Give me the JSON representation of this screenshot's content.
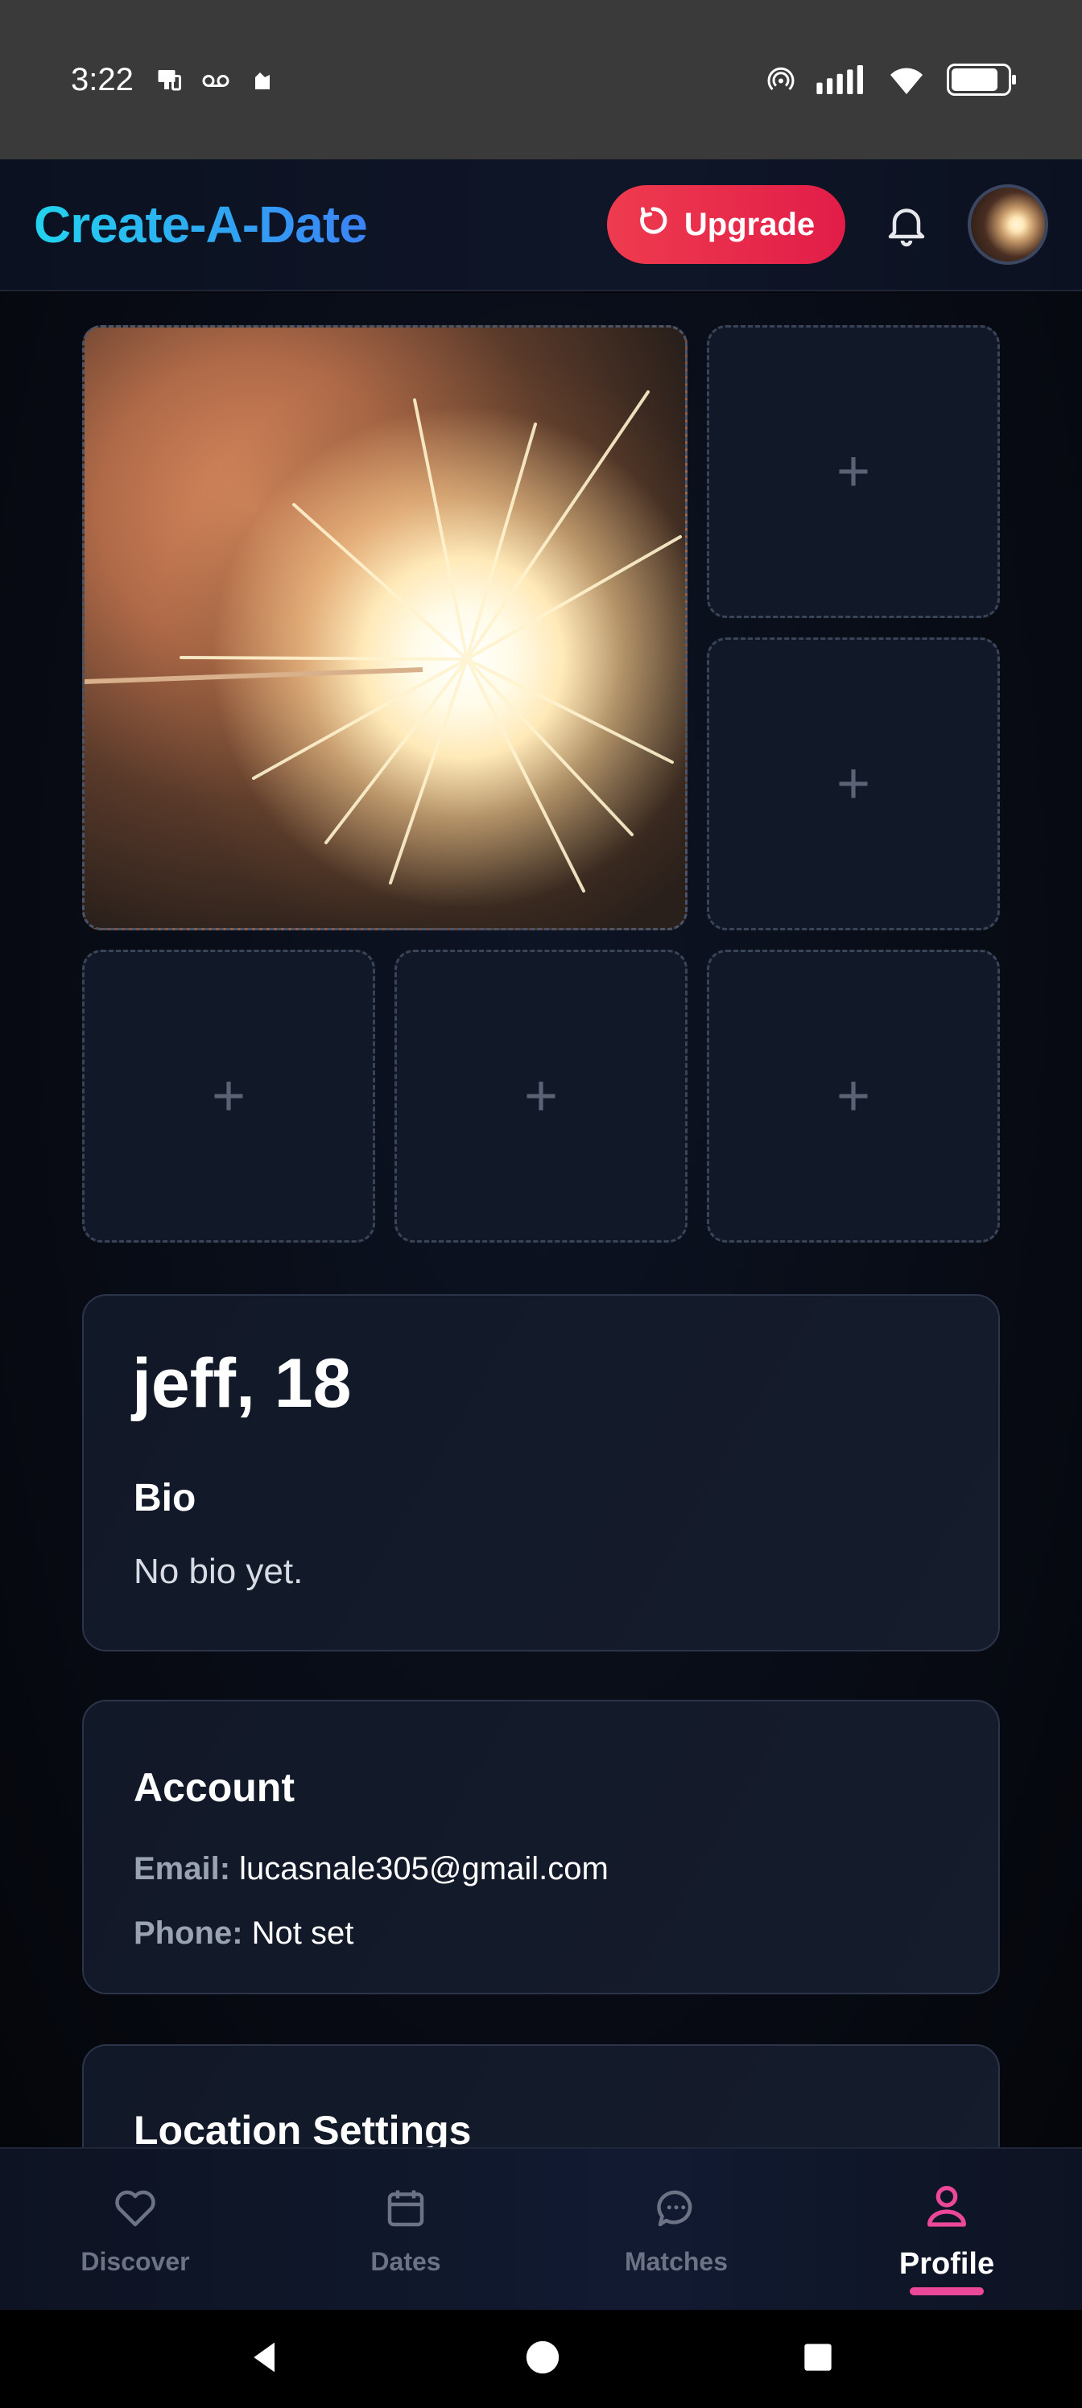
{
  "status_bar": {
    "time": "3:22",
    "left_icons": [
      "screen-cast-icon",
      "voicemail-icon",
      "cloud-icon"
    ],
    "right_icons": [
      "hotspot-icon",
      "signal-icon",
      "wifi-icon",
      "battery-icon"
    ]
  },
  "header": {
    "app_title": "Create-A-Date",
    "upgrade_label": "Upgrade",
    "colors": {
      "brand_start": "#22d3ee",
      "brand_end": "#3b82f6",
      "upgrade": "#e11d48"
    }
  },
  "photos": {
    "add_label": "+",
    "slots": [
      "filled",
      "empty",
      "empty",
      "empty",
      "empty",
      "empty"
    ]
  },
  "profile": {
    "name_age": "jeff, 18",
    "bio_label": "Bio",
    "bio_text": "No bio yet."
  },
  "account": {
    "title": "Account",
    "email_label": "Email:",
    "email_value": "lucasnale305@gmail.com",
    "phone_label": "Phone:",
    "phone_value": "Not set"
  },
  "location": {
    "title": "Location Settings"
  },
  "bottom_nav": {
    "items": [
      {
        "label": "Discover",
        "icon": "heart-icon",
        "active": false
      },
      {
        "label": "Dates",
        "icon": "calendar-icon",
        "active": false
      },
      {
        "label": "Matches",
        "icon": "chat-icon",
        "active": false
      },
      {
        "label": "Profile",
        "icon": "user-icon",
        "active": true
      }
    ],
    "active_color": "#ec4899"
  }
}
